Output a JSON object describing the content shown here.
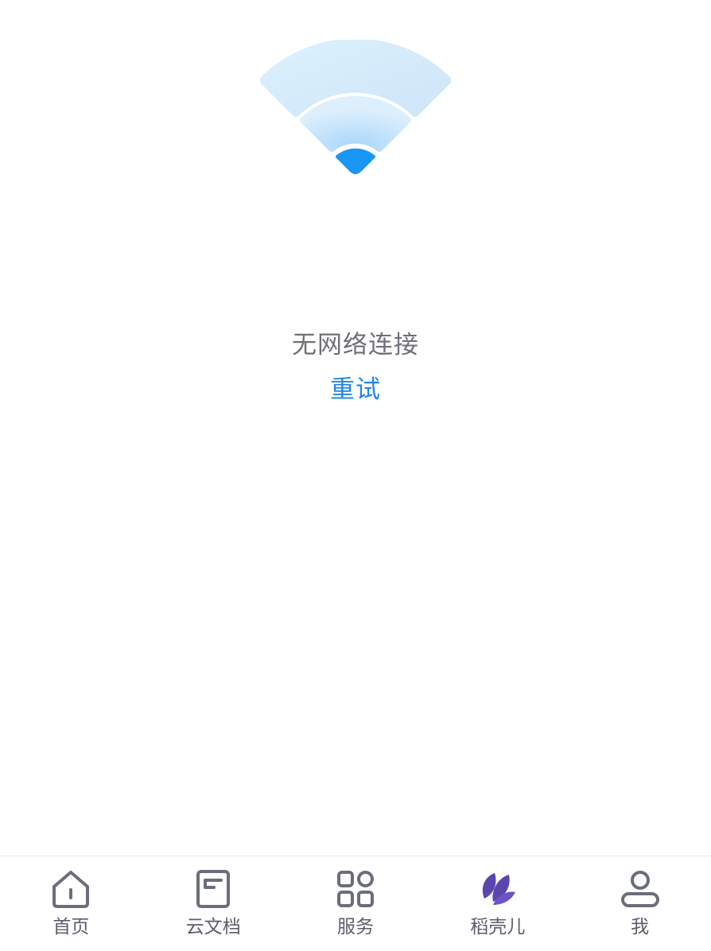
{
  "empty_state": {
    "message": "无网络连接",
    "retry_label": "重试"
  },
  "tabbar": {
    "active_index": 3,
    "items": [
      {
        "label": "首页",
        "icon": "home-icon"
      },
      {
        "label": "云文档",
        "icon": "document-icon"
      },
      {
        "label": "服务",
        "icon": "grid-icon"
      },
      {
        "label": "稻壳儿",
        "icon": "leaf-icon"
      },
      {
        "label": "我",
        "icon": "person-icon"
      }
    ]
  },
  "colors": {
    "accent_blue": "#1f86e6",
    "active_tab_purple": "#5b46b0",
    "icon_gray": "#6b6e7a",
    "wifi_light": "#d4ecfb",
    "wifi_core": "#1a96f5"
  }
}
